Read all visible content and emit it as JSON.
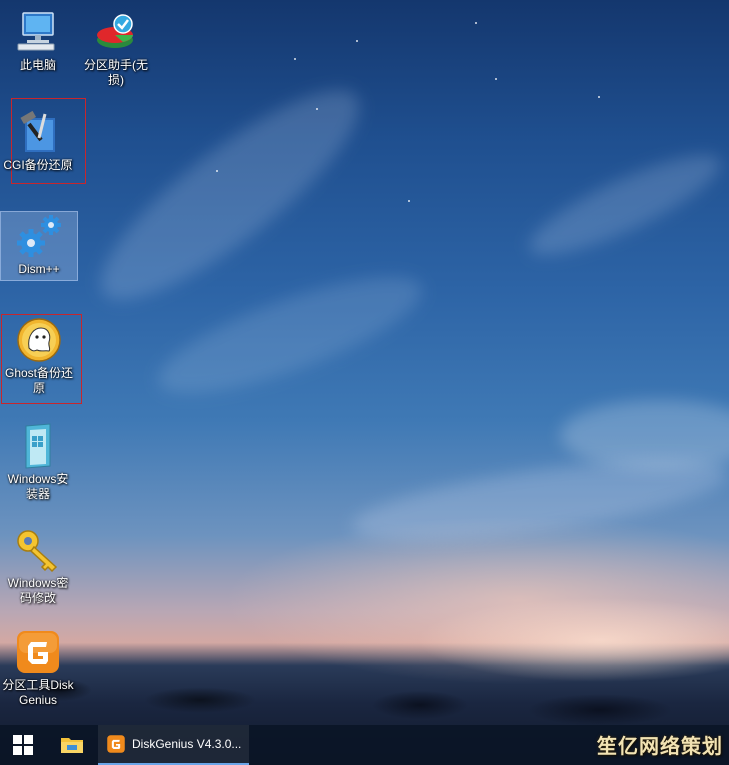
{
  "desktop": {
    "icons": [
      {
        "label": "此电脑",
        "icon": "computer-icon"
      },
      {
        "label": "分区助手(无损)",
        "icon": "partition-assistant-icon"
      },
      {
        "label": "CGI备份还原",
        "icon": "cgi-backup-icon"
      },
      {
        "label": "Dism++",
        "icon": "gears-icon"
      },
      {
        "label": "Ghost备份还原",
        "icon": "ghost-icon"
      },
      {
        "label": "Windows安装器",
        "icon": "windows-installer-icon"
      },
      {
        "label": "Windows密码修改",
        "icon": "key-icon"
      },
      {
        "label": "分区工具DiskGenius",
        "icon": "diskgenius-icon"
      }
    ]
  },
  "taskbar": {
    "start_icon": "windows-start-icon",
    "explorer_icon": "file-explorer-icon",
    "active_app_label": "DiskGenius V4.3.0..."
  },
  "watermark": "笙亿网络策划",
  "colors": {
    "highlight_frame": "#c8262c",
    "taskbar": "#0a1426",
    "accent": "#6aa5e8"
  }
}
